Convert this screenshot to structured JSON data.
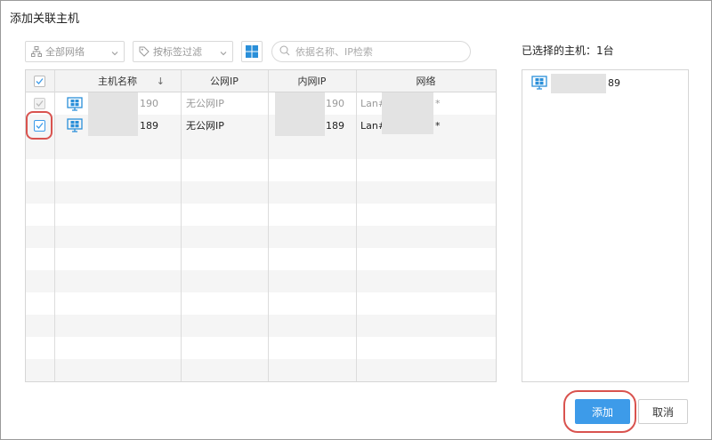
{
  "dialog": {
    "title": "添加关联主机"
  },
  "toolbar": {
    "network_filter": "全部网络",
    "tag_filter": "按标签过滤",
    "search_placeholder": "依据名称、IP检索"
  },
  "table": {
    "columns": [
      "主机名称",
      "公网IP",
      "内网IP",
      "网络"
    ],
    "sort_glyph": "↓",
    "rows": [
      {
        "name": "190",
        "public_ip": "无公网IP",
        "private_ip": "190",
        "network": "Lan#",
        "network_suffix": "*",
        "checked": true,
        "disabled": true
      },
      {
        "name": "189",
        "public_ip": "无公网IP",
        "private_ip": "189",
        "network": "Lan#",
        "network_suffix": "*",
        "checked": true,
        "disabled": false
      }
    ]
  },
  "selected": {
    "title": "已选择的主机：1台",
    "items": [
      {
        "name": "89"
      }
    ]
  },
  "buttons": {
    "add": "添加",
    "cancel": "取消"
  },
  "colors": {
    "primary": "#3d9be9",
    "windows_icon": "#2a8fd9",
    "highlight": "#d9534f"
  }
}
